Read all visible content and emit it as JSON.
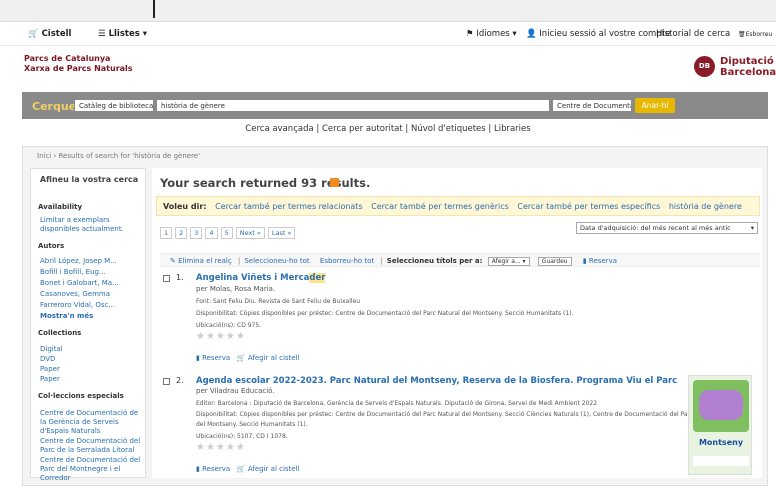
{
  "nav": {
    "cart": "Cistell",
    "lists": "Llistes",
    "languages": "Idiomes",
    "login": "Inicieu sessió al vostre compte",
    "history": "Historial de cerca",
    "clear": "Esborreu"
  },
  "brand": {
    "line1": "Parcs de Catalunya",
    "line2": "Xarxa de Parcs Naturals",
    "diputacio_line1": "Diputació",
    "diputacio_line2": "Barcelona",
    "logo_text": "DB"
  },
  "search": {
    "label": "Cerqueu",
    "catalog_option": "Catàleg de biblioteca",
    "query": "història de gènere",
    "library_option": "Centre de Documentació",
    "submit": "Anar-hi"
  },
  "links": {
    "advanced": "Cerca avançada",
    "authority": "Cerca per autoritat",
    "tags": "Núvol d'etiquetes",
    "libraries": "Libraries"
  },
  "breadcrumb": {
    "home": "Inici",
    "current": "Results of search for 'història de gènere'"
  },
  "facets": {
    "title": "Afineu la vostra cerca",
    "availability_heading": "Availability",
    "availability_link": "Limitar a exemplars disponibles actualment.",
    "authors_heading": "Autors",
    "authors": [
      "Abril López, Josep M...",
      "Bofill i Bofill, Eug...",
      "Bonet i Galobart, Ma...",
      "Casanoves, Gemma",
      "Farreroro Vidal, Osc..."
    ],
    "show_more": "Mostra'n més",
    "collections_heading": "Collections",
    "collections": [
      "Digital",
      "DVD",
      "Paper",
      "Paper"
    ],
    "special_heading": "Col·leccions especials",
    "special": [
      "Centre de Documentació de la Gerència de Serveis d'Espais Naturals",
      "Centre de Documentació del Parc de la Serralada Litoral",
      "Centre de Documentació del Parc del Montnegre i el Corredor"
    ]
  },
  "results": {
    "summary": "Your search returned 93 results.",
    "suggest_label": "Voleu dir:",
    "suggestions": [
      "Cercar també per termes relacionats",
      "Cercar també per termes genèrics",
      "Cercar també per termes específics",
      "història de gènere"
    ],
    "pages": [
      "1",
      "2",
      "3",
      "4",
      "5",
      "Next »",
      "Last »"
    ],
    "sort": "Data d'adquisició: del més recent al més antic",
    "toolbar": {
      "clear_all": "Elimina el realç",
      "select_all": "Seleccioneu-ho tot",
      "clear_selection": "Esborreu-ho tot",
      "selected_label": "Seleccioneu títols per a:",
      "add_to": "Afegir a...",
      "save": "Guardeu",
      "reserve": "Reserva"
    },
    "items": [
      {
        "num": "1.",
        "title_a": "Angelina Viñets i Merca",
        "title_hl": "der",
        "author": "per Molas, Rosa Maria.",
        "source": "Font: Sant Feliu Diu. Revista de Sant Feliu de Buixalleu",
        "availability": "Disponibilitat: Còpies disponibles per préstec: Centre de Documentació del Parc Natural del Montseny. Secció Humanitats (1).",
        "location": "Ubicació(ns): CD 975.",
        "reserve": "Reserva",
        "add_cart": "Afegir al cistell"
      },
      {
        "num": "2.",
        "title": "Agenda escolar 2022-2023. Parc Natural del Montseny, Reserva de la Biosfera. Programa Viu el Parc",
        "author": "per Viladrau Educació.",
        "source": "Editor: Barcelona : Diputació de Barcelona, Gerència de Serveis d'Espais Naturals. Diputació de Girona, Servei de Medi Ambient 2022",
        "availability": "Disponibilitat: Còpies disponibles per préstec: Centre de Documentació del Parc Natural del Montseny. Secció Ciències Naturals (1), Centre de Documentació del Parc Natural",
        "availability2": "del Montseny. Secció Humanitats (1).",
        "location": "Ubicació(ns): 5107, CD I 1078.",
        "reserve": "Reserva",
        "add_cart": "Afegir al cistell",
        "cover_title": "Montseny"
      }
    ]
  },
  "stars": "★★★★★"
}
